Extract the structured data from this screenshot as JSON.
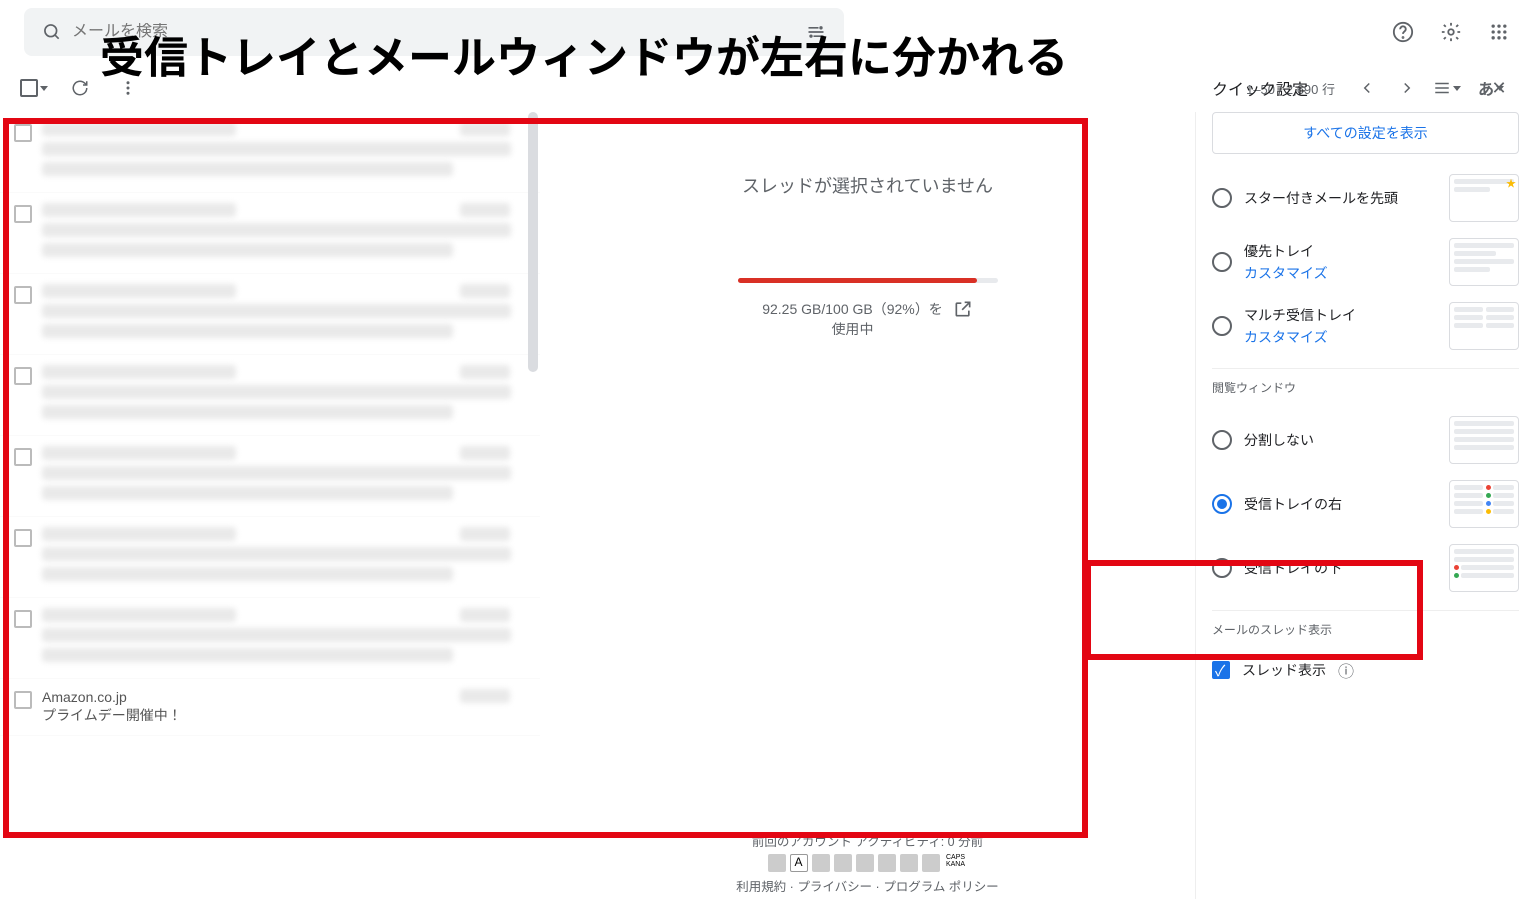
{
  "search": {
    "placeholder": "メールを検索"
  },
  "annotation_title": "受信トレイとメールウィンドウが左右に分かれる",
  "toolbar": {
    "page_count": "1–50 / 2,690 行"
  },
  "reading_pane": {
    "no_selection": "スレッドが選択されていません",
    "storage_text_line1": "92.25 GB/100 GB（92%）を",
    "storage_text_line2": "使用中",
    "storage_percent": 92
  },
  "footer": {
    "activity": "前回のアカウント アクティビティ: 0 分前",
    "terms": "利用規約",
    "privacy": "プライバシー",
    "program": "プログラム ポリシー",
    "sep": " · "
  },
  "quick_settings": {
    "title": "クイック設定",
    "all_button": "すべての設定を表示",
    "inbox_type": {
      "starred_first": "スター付きメールを先頭",
      "priority": "優先トレイ",
      "multi": "マルチ受信トレイ",
      "customize": "カスタマイズ"
    },
    "reading_section": {
      "title": "閲覧ウィンドウ",
      "no_split": "分割しない",
      "right": "受信トレイの右",
      "below": "受信トレイの下"
    },
    "threading": {
      "title": "メールのスレッド表示",
      "label": "スレッド表示"
    }
  },
  "list_last": {
    "sender": "Amazon.co.jp",
    "subject": "プライムデー開催中！"
  }
}
